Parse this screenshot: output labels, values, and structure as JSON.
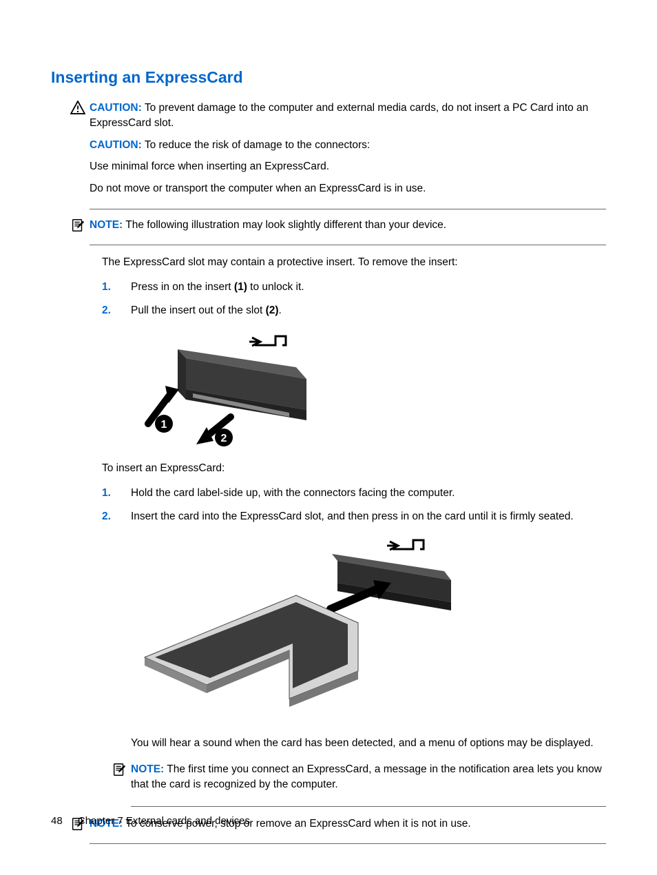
{
  "heading": "Inserting an ExpressCard",
  "caution1": {
    "label": "CAUTION:",
    "p1": "To prevent damage to the computer and external media cards, do not insert a PC Card into an ExpressCard slot.",
    "label2": "CAUTION:",
    "p2": "To reduce the risk of damage to the connectors:",
    "p3": "Use minimal force when inserting an ExpressCard.",
    "p4": "Do not move or transport the computer when an ExpressCard is in use."
  },
  "note1": {
    "label": "NOTE:",
    "text": "The following illustration may look slightly different than your device."
  },
  "intro1": "The ExpressCard slot may contain a protective insert. To remove the insert:",
  "steps1": [
    {
      "num": "1.",
      "pre": "Press in on the insert ",
      "bold": "(1)",
      "post": " to unlock it."
    },
    {
      "num": "2.",
      "pre": "Pull the insert out of the slot ",
      "bold": "(2)",
      "post": "."
    }
  ],
  "intro2": "To insert an ExpressCard:",
  "steps2": [
    {
      "num": "1.",
      "text": "Hold the card label-side up, with the connectors facing the computer."
    },
    {
      "num": "2.",
      "text": "Insert the card into the ExpressCard slot, and then press in on the card until it is firmly seated.",
      "after": "You will hear a sound when the card has been detected, and a menu of options may be displayed."
    }
  ],
  "note2": {
    "label": "NOTE:",
    "text": "The first time you connect an ExpressCard, a message in the notification area lets you know that the card is recognized by the computer."
  },
  "note3": {
    "label": "NOTE:",
    "text": "To conserve power, stop or remove an ExpressCard when it is not in use."
  },
  "footer": {
    "page": "48",
    "chapter": "Chapter 7   External cards and devices"
  }
}
